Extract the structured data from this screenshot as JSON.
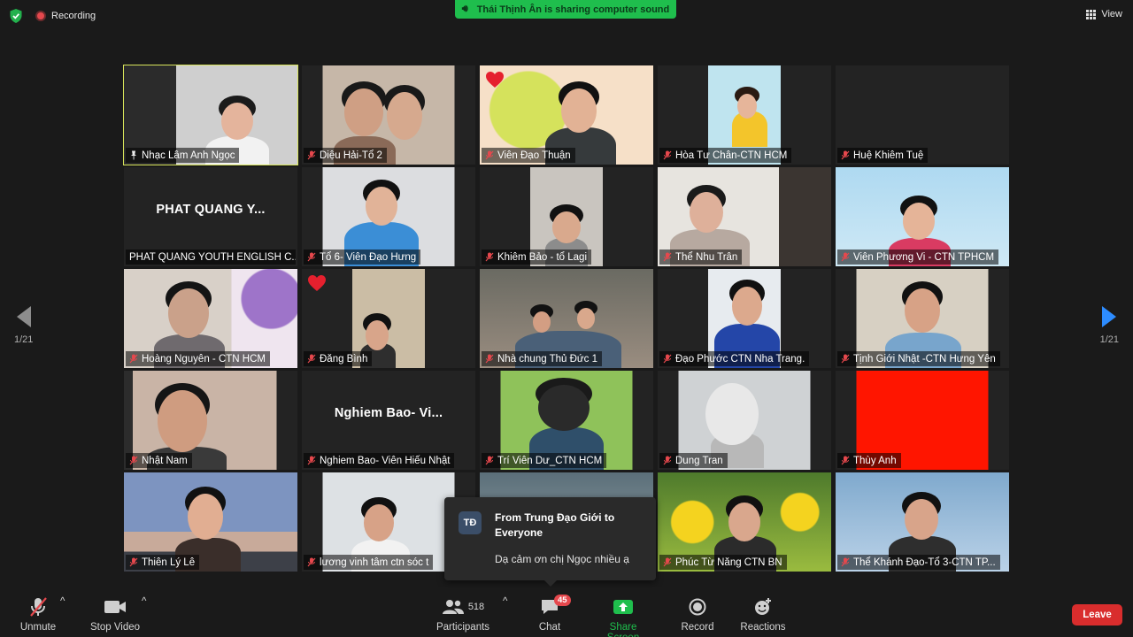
{
  "topbar": {
    "recording_label": "Recording",
    "share_banner": "Thái Thịnh Ân is sharing computer sound",
    "view_label": "View"
  },
  "nav": {
    "left_page": "1/21",
    "right_page": "1/21"
  },
  "tiles": [
    {
      "name": "Nhạc Lâm Anh Ngọc",
      "muted": false,
      "active": true
    },
    {
      "name": "Diệu Hải-Tổ 2",
      "muted": true
    },
    {
      "name": "Viên Đạo Thuận",
      "muted": true,
      "reaction": "heart"
    },
    {
      "name": "Hòa Tư Chân-CTN HCM",
      "muted": true
    },
    {
      "name": "Huệ Khiêm Tuệ",
      "muted": true
    },
    {
      "name": "PHAT QUANG YOUTH ENGLISH C...",
      "muted": false,
      "big_name": "PHAT QUANG Y..."
    },
    {
      "name": "Tổ 6- Viên Đạo Hưng",
      "muted": true
    },
    {
      "name": "Khiêm Bảo -  tổ Lagi",
      "muted": true
    },
    {
      "name": "Thể Nhu Trân",
      "muted": true
    },
    {
      "name": "Viên Phương Vi - CTN TPHCM",
      "muted": true
    },
    {
      "name": "Hoàng Nguyên - CTN HCM",
      "muted": true
    },
    {
      "name": "Đăng Bình",
      "muted": true,
      "reaction": "heart"
    },
    {
      "name": "Nhà chung Thủ Đức 1",
      "muted": true
    },
    {
      "name": "Đạo Phước CTN Nha Trang.",
      "muted": true
    },
    {
      "name": "Tịnh Giới Nhật -CTN Hưng Yên",
      "muted": true
    },
    {
      "name": "Nhật Nam",
      "muted": true
    },
    {
      "name": "Nghiem Bao- Viên Hiếu Nhật",
      "muted": true,
      "big_name": "Nghiem  Bao- Vi..."
    },
    {
      "name": "Trí Viên Dư_CTN HCM",
      "muted": true
    },
    {
      "name": "Dung Tran",
      "muted": true
    },
    {
      "name": "Thùy Anh",
      "muted": true
    },
    {
      "name": "Thiên Lý Lê",
      "muted": true
    },
    {
      "name": "lương vinh tâm  ctn  sóc t",
      "muted": true
    },
    {
      "name": "",
      "muted": false
    },
    {
      "name": "Phúc Từ Năng CTN BN",
      "muted": true
    },
    {
      "name": "Thể Khánh Đạo-Tổ 3-CTN TP...",
      "muted": true
    }
  ],
  "chat_popup": {
    "avatar_initials": "TĐ",
    "from": "From Trung Đạo Giới to Everyone",
    "message": "Dạ cảm ơn chị Ngọc nhiều ạ"
  },
  "toolbar": {
    "unmute": "Unmute",
    "stop_video": "Stop Video",
    "participants": "Participants",
    "participants_count": "518",
    "chat": "Chat",
    "chat_badge": "45",
    "share_screen": "Share Screen",
    "record": "Record",
    "reactions": "Reactions",
    "leave": "Leave"
  },
  "colors": {
    "share_green": "#1fbe4d",
    "active_outline": "#d7e35a",
    "leave_red": "#d92d2d",
    "nav_blue": "#2d8cff"
  }
}
